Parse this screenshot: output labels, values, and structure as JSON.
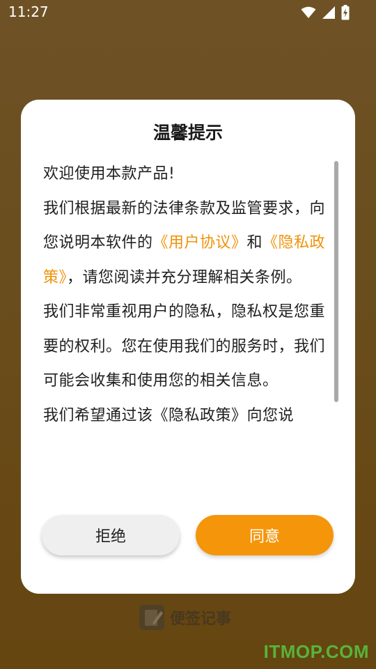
{
  "status_bar": {
    "time": "11:27",
    "icons": [
      "wifi-icon",
      "signal-icon",
      "battery-charging-icon"
    ]
  },
  "dialog": {
    "title": "温馨提示",
    "body": {
      "line1": "欢迎使用本款产品!",
      "para2_pre": "我们根据最新的法律条款及监管要求，向您说明本软件的",
      "link_user_agreement": "《用户协议》",
      "para2_mid": "和",
      "link_privacy_policy": "《隐私政策》",
      "para2_post": "，请您阅读并充分理解相关条例。",
      "para3": "我们非常重视用户的隐私，隐私权是您重要的权利。您在使用我们的服务时，我们可能会收集和使用您的相关信息。",
      "para4": "我们希望通过该《隐私政策》向您说"
    },
    "reject_label": "拒绝",
    "agree_label": "同意"
  },
  "background": {
    "app_name": "便签记事"
  },
  "watermark": "ITMOP.COM",
  "colors": {
    "accent": "#f5950a",
    "link": "#f0920a",
    "backdrop": "#6a4d1c"
  }
}
